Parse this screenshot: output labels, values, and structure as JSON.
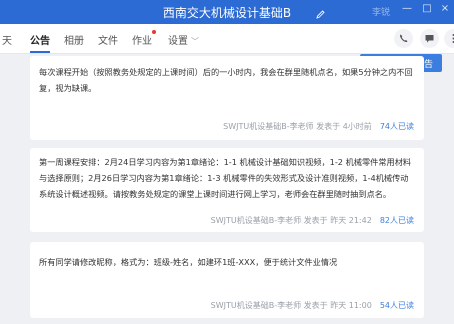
{
  "window": {
    "title": "西南交大机械设计基础B",
    "user": "李锐"
  },
  "tabs": [
    {
      "label": "天"
    },
    {
      "label": "公告"
    },
    {
      "label": "相册"
    },
    {
      "label": "文件"
    },
    {
      "label": "作业"
    },
    {
      "label": "设置"
    }
  ],
  "post_button": {
    "label": "发布新公告"
  },
  "announcements": [
    {
      "text": "每次课程开始（按照教务处规定的上课时间）后的一小时内，我会在群里随机点名，如果5分钟之内不回复，视为缺课。",
      "meta": "SWJTU机设基础B-李老师 发表于 4小时前",
      "read": "74人已读"
    },
    {
      "text": "第一周课程安排：2月24日学习内容为第1章绪论：1-1 机械设计基础知识视频，1-2 机械零件常用材料与选择原则；2月26日学习内容为第1章绪论：1-3 机械零件的失效形式及设计准则视频，1-4机械传动系统设计概述视频。请按教务处规定的课堂上课时间进行网上学习，老师会在群里随时抽到点名。",
      "meta": "SWJTU机设基础B-李老师 发表于 昨天 21:42",
      "read": "82人已读"
    },
    {
      "text": "所有同学请修改昵称，格式为：班级-姓名，如建环1班-XXX，便于统计文件业情况",
      "meta": "SWJTU机设基础B-李老师 发表于 昨天 11:00",
      "read": "54人已读"
    }
  ],
  "colors": {
    "accent": "#2c6bd3",
    "read": "#3c7ee0",
    "dot": "#e53935"
  }
}
